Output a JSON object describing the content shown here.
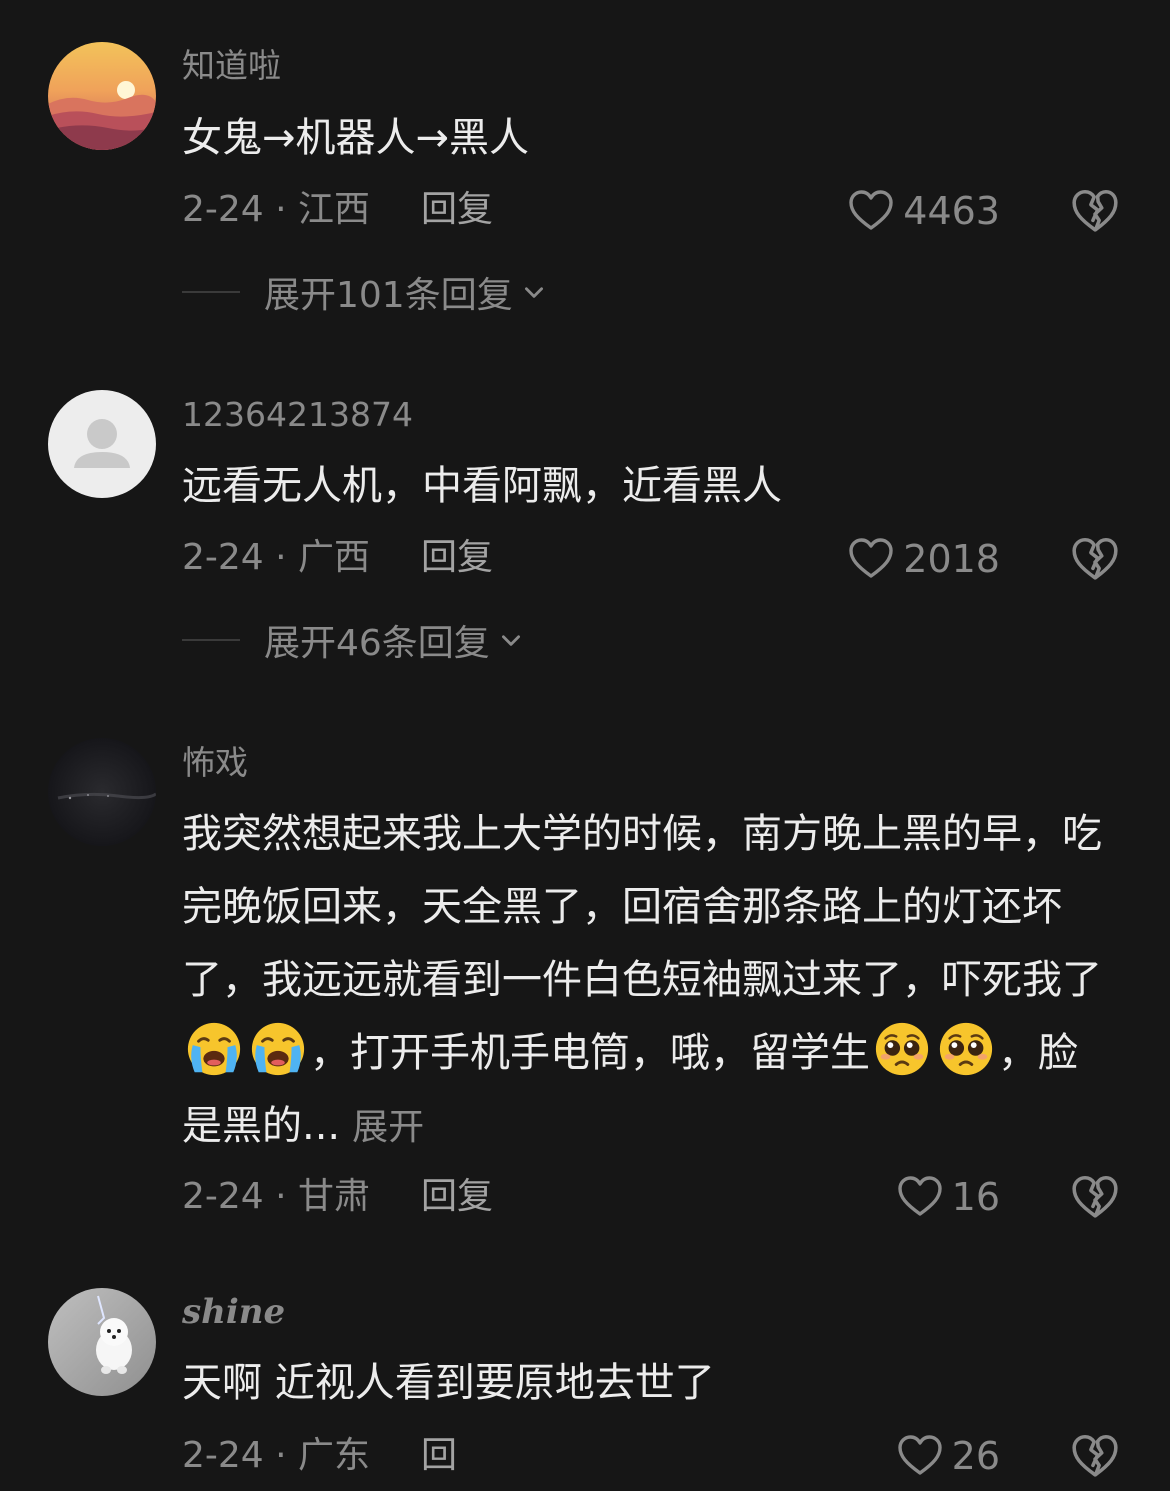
{
  "comments": [
    {
      "username": "知道啦",
      "text": "女鬼→机器人→黑人",
      "date_location": "2-24 · 江西",
      "reply_label": "回复",
      "likes": "4463",
      "expand_label": "展开101条回复",
      "avatar_icon": "sunset-avatar"
    },
    {
      "username": "12364213874",
      "text": "远看无人机，中看阿飘，近看黑人",
      "date_location": "2-24 · 广西",
      "reply_label": "回复",
      "likes": "2018",
      "expand_label": "展开46条回复",
      "avatar_icon": "default-person-avatar"
    },
    {
      "username": "怖戏",
      "text_part1": "我突然想起来我上大学的时候，南方晚上黑的早，吃完晚饭回来，天全黑了，回宿舍那条路上的灯还坏了，我远远就看到一件白色短袖飘过来了，吓死我了",
      "text_part2": "，打开手机手电筒，哦，留学生",
      "text_part3": "，脸是黑的...",
      "more_label": "展开",
      "date_location": "2-24 · 甘肃",
      "reply_label": "回复",
      "likes": "16",
      "avatar_icon": "night-sky-avatar",
      "emoji_1": "loudly-crying-face-emoji",
      "emoji_2": "pleading-face-emoji"
    },
    {
      "username": "shine",
      "text": "天啊  近视人看到要原地去世了",
      "date_location": "2-24 · 广东",
      "reply_label": "回",
      "likes": "26",
      "avatar_icon": "white-dog-avatar"
    }
  ],
  "colors": {
    "background": "#161616",
    "text_primary": "#ececec",
    "text_secondary": "#8a8a8a"
  }
}
